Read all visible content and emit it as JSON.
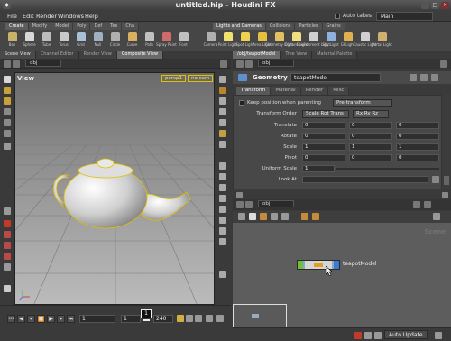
{
  "window": {
    "title": "untitled.hip - Houdini FX"
  },
  "menu": {
    "items": [
      "File",
      "Edit",
      "Render",
      "Windows",
      "Help"
    ],
    "auto_takes_label": "Auto takes",
    "desktop": "Main"
  },
  "shelf": {
    "tabs_left": [
      "Create",
      "Modify",
      "Model",
      "Poly",
      "Def",
      "Tex",
      "Cha"
    ],
    "tabs_right": [
      "Lights and Cameras",
      "Collisions",
      "Particles",
      "Grains"
    ],
    "tools_left": [
      "Box",
      "Sphere",
      "Tube",
      "Torus",
      "Grid",
      "Null",
      "Circle",
      "Curve",
      "Path",
      "Spray Paint",
      "Font"
    ],
    "tools_right": [
      "Camera",
      "Point Light",
      "Spot Light",
      "Area Light",
      "Geometry Light",
      "Distant Light",
      "Environment Light",
      "Sky Light",
      "GI Light",
      "Caustic Light",
      "Portal Light"
    ]
  },
  "left_pane": {
    "tabs": [
      "Scene View",
      "Channel Editor",
      "Render View",
      "Composite View"
    ],
    "path": "obj",
    "viewport_title": "View",
    "viewport_buttons": [
      "persp1",
      "no cam"
    ]
  },
  "playbar": {
    "start_frame": "1",
    "current_frame": "1",
    "end_frame": "240",
    "frame_marker": "1"
  },
  "param_pane": {
    "tabs": [
      "/obj/teapotModel",
      "Tree View",
      "Material Palette"
    ],
    "path": "obj",
    "node_type": "Geometry",
    "node_name": "teapotModel",
    "subtabs": [
      "Transform",
      "Material",
      "Render",
      "Misc"
    ],
    "keep_position_label": "Keep position when parenting",
    "keep_position_value": "Pre-transform",
    "transform_order_label": "Transform Order",
    "transform_order_value": "Scale Rot Trans",
    "rotate_order_value": "Rx Ry Rz",
    "rows": [
      {
        "label": "Translate",
        "values": [
          "0",
          "0",
          "0"
        ]
      },
      {
        "label": "Rotate",
        "values": [
          "0",
          "0",
          "0"
        ]
      },
      {
        "label": "Scale",
        "values": [
          "1",
          "1",
          "1"
        ]
      },
      {
        "label": "Pivot",
        "values": [
          "0",
          "0",
          "0"
        ]
      }
    ],
    "uniform_scale_label": "Uniform Scale",
    "uniform_scale_value": "1",
    "look_at_label": "Look At"
  },
  "network": {
    "path": "obj",
    "watermark": "Scene",
    "node_label": "teapotModel"
  },
  "status": {
    "auto_update": "Auto Update"
  },
  "colors": {
    "accent_yellow": "#e0c000",
    "node_blue": "#3b7bd6",
    "node_green": "#6fbf3f"
  }
}
